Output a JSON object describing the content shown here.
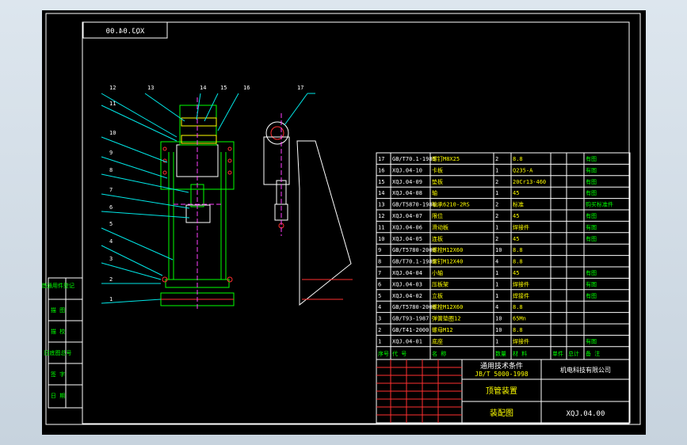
{
  "title_box": "XQJ.04.00",
  "leaders_left": [
    "12",
    "13",
    "14",
    "15",
    "16",
    "11",
    "10",
    "9",
    "8",
    "7",
    "6",
    "5",
    "4",
    "3",
    "2",
    "1"
  ],
  "leader_right": "17",
  "side_labels": [
    "借通用件登记",
    "描 图",
    "描 校",
    "旧底图总号",
    "签 字",
    "日 期"
  ],
  "bom_rows": [
    [
      "17",
      "GB/T70.1-1985",
      "螺钉M8X25",
      "2",
      "8.8",
      "",
      "",
      "有图"
    ],
    [
      "16",
      "XQJ.04-10",
      "卡板",
      "1",
      "Q235-A",
      "",
      "",
      "有图"
    ],
    [
      "15",
      "XQJ.04-09",
      "垫板",
      "2",
      "20Cr13-460",
      "",
      "",
      "有图"
    ],
    [
      "14",
      "XQJ.04-08",
      "轴",
      "1",
      "45",
      "",
      "",
      "有图"
    ],
    [
      "13",
      "GB/T5870-1986",
      "轴承6210-2RS",
      "2",
      "标准",
      "",
      "",
      "购买标准件"
    ],
    [
      "12",
      "XQJ.04-07",
      "限位",
      "2",
      "45",
      "",
      "",
      "有图"
    ],
    [
      "11",
      "XQJ.04-06",
      "滑动板",
      "1",
      "焊接件",
      "",
      "",
      "有图"
    ],
    [
      "10",
      "XQJ.04-05",
      "连板",
      "2",
      "45",
      "",
      "",
      "有图"
    ],
    [
      "9",
      "GB/T5780-2000",
      "螺栓M12X60",
      "10",
      "8.8",
      "",
      "",
      ""
    ],
    [
      "8",
      "GB/T70.1-1985",
      "螺钉M12X40",
      "4",
      "8.8",
      "",
      "",
      ""
    ],
    [
      "7",
      "XQJ.04-04",
      "小轴",
      "1",
      "45",
      "",
      "",
      "有图"
    ],
    [
      "6",
      "XQJ.04-03",
      "压板架",
      "1",
      "焊接件",
      "",
      "",
      "有图"
    ],
    [
      "5",
      "XQJ.04-02",
      "立板",
      "1",
      "焊接件",
      "",
      "",
      "有图"
    ],
    [
      "4",
      "GB/T5780-2000",
      "螺栓M12X60",
      "4",
      "8.8",
      "",
      "",
      ""
    ],
    [
      "3",
      "GB/T93-1987",
      "弹簧垫圈12",
      "10",
      "65Mn",
      "",
      "",
      ""
    ],
    [
      "2",
      "GB/T41-2000",
      "螺母M12",
      "10",
      "8.8",
      "",
      "",
      ""
    ],
    [
      "1",
      "XQJ.04-01",
      "底座",
      "1",
      "焊接件",
      "",
      "",
      "有图"
    ]
  ],
  "bom_header": [
    "序号",
    "代 号",
    "名 称",
    "数量",
    "材 料",
    "单件",
    "总计",
    "备 注"
  ],
  "title_block": {
    "standard_label": "通用技术条件",
    "standard_no": "JB/T 5000-1998",
    "company": "机电科技有限公司",
    "drawing_name": "顶管装置",
    "drawing_type": "装配图",
    "drawing_no": "XQJ.04.00"
  }
}
